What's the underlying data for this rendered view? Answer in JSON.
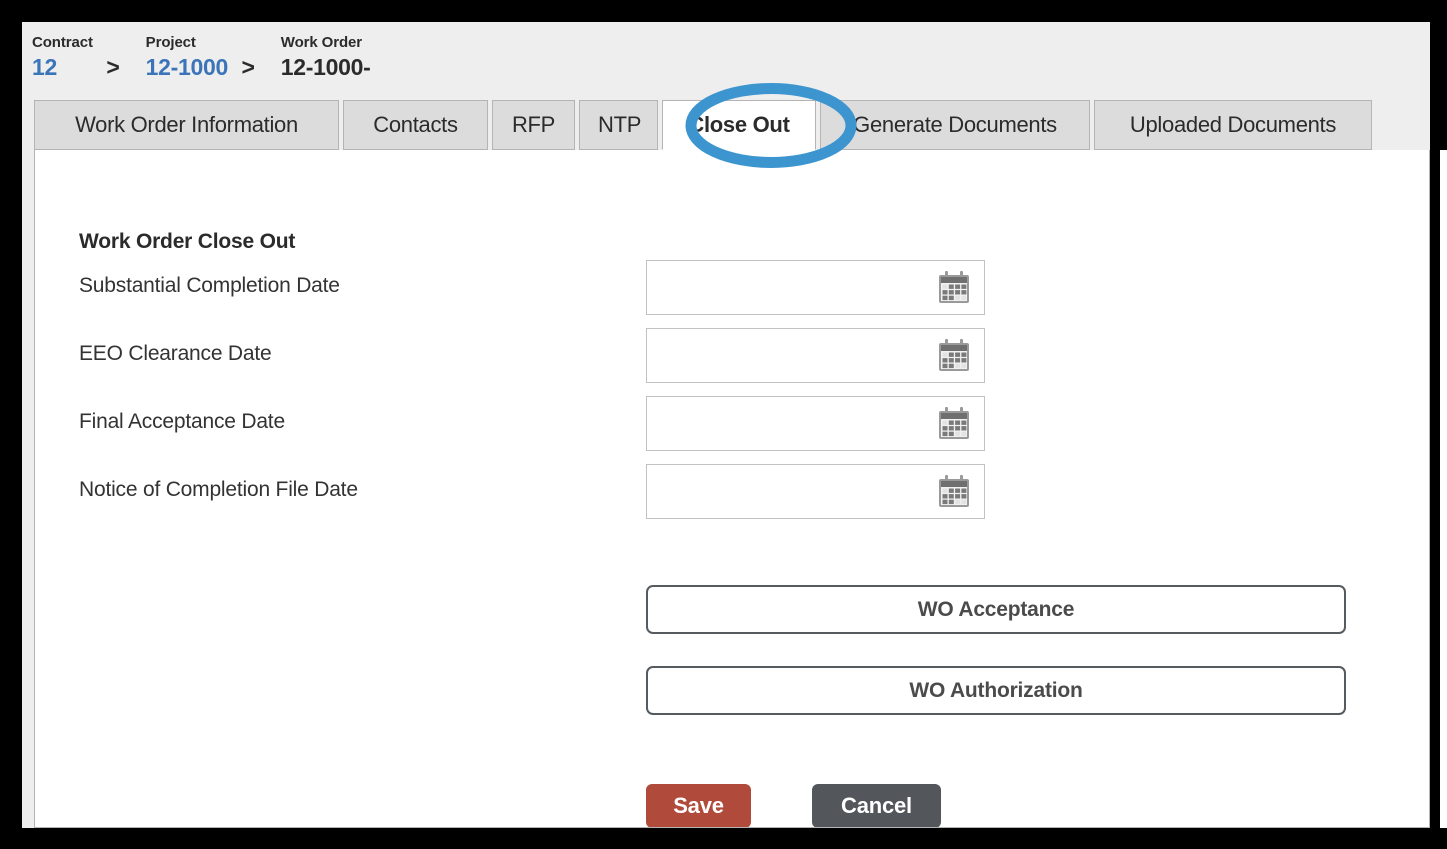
{
  "breadcrumb": {
    "contract_label": "Contract",
    "contract_value": "12",
    "separator1": ">",
    "project_label": "Project",
    "project_value": "12-1000",
    "separator2": ">",
    "workorder_label": "Work Order",
    "workorder_value": "12-1000-"
  },
  "tabs": [
    {
      "label": "Work Order Information",
      "active": false
    },
    {
      "label": "Contacts",
      "active": false
    },
    {
      "label": "RFP",
      "active": false
    },
    {
      "label": "NTP",
      "active": false
    },
    {
      "label": "Close Out",
      "active": true
    },
    {
      "label": "Generate Documents",
      "active": false
    },
    {
      "label": "Uploaded Documents",
      "active": false
    }
  ],
  "content": {
    "section_title": "Work Order Close Out",
    "fields": [
      {
        "label": "Substantial Completion Date",
        "value": "",
        "placeholder": "",
        "icon": "calendar-icon"
      },
      {
        "label": "EEO Clearance Date",
        "value": "",
        "placeholder": "",
        "icon": "calendar-icon"
      },
      {
        "label": "Final Acceptance Date",
        "value": "",
        "placeholder": "",
        "icon": "calendar-icon"
      },
      {
        "label": "Notice of Completion File Date",
        "value": "",
        "placeholder": "",
        "icon": "calendar-icon"
      }
    ],
    "actions": [
      {
        "label": "WO Acceptance"
      },
      {
        "label": "WO Authorization"
      }
    ],
    "save_label": "Save",
    "cancel_label": "Cancel"
  },
  "annotation": {
    "shape": "ellipse-highlight",
    "target_tab": "Close Out",
    "color": "#3d95d0"
  },
  "colors": {
    "page_background": "#eeeeee",
    "panel_background": "#ffffff",
    "tab_inactive": "#dcdcdc",
    "tab_border": "#b4b4b4",
    "link_text": "#3b74b8",
    "body_text": "#333333",
    "save_button": "#b04b3c",
    "cancel_button": "#53565a",
    "action_button_border": "#555b5f",
    "annotation_blue": "#3d95d0",
    "frame": "#000000"
  }
}
